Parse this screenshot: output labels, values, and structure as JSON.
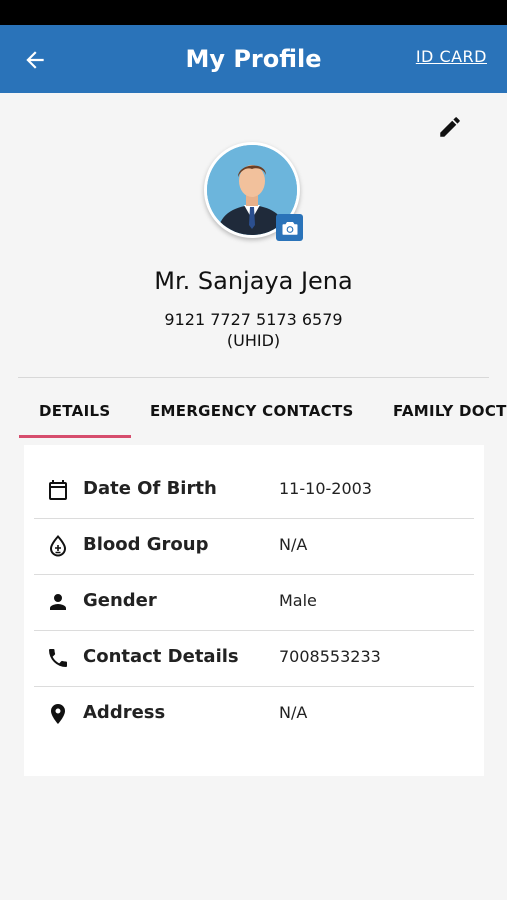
{
  "header": {
    "title": "My Profile",
    "id_card_label": "ID CARD"
  },
  "profile": {
    "name": "Mr. Sanjaya Jena",
    "uhid": "9121 7727 5173 6579",
    "uhid_label": "(UHID)"
  },
  "tabs": [
    {
      "label": "DETAILS",
      "active": true
    },
    {
      "label": "EMERGENCY CONTACTS",
      "active": false
    },
    {
      "label": "FAMILY DOCTOR",
      "active": false
    }
  ],
  "details": [
    {
      "icon": "calendar-icon",
      "label": "Date Of Birth",
      "value": "11-10-2003"
    },
    {
      "icon": "blood-drop-icon",
      "label": "Blood Group",
      "value": "N/A"
    },
    {
      "icon": "person-icon",
      "label": "Gender",
      "value": "Male"
    },
    {
      "icon": "phone-icon",
      "label": "Contact Details",
      "value": "7008553233"
    },
    {
      "icon": "location-pin-icon",
      "label": "Address",
      "value": "N/A"
    }
  ],
  "colors": {
    "app_bar": "#2a73b9",
    "tab_indicator": "#d64d6d",
    "background": "#f5f5f5"
  }
}
